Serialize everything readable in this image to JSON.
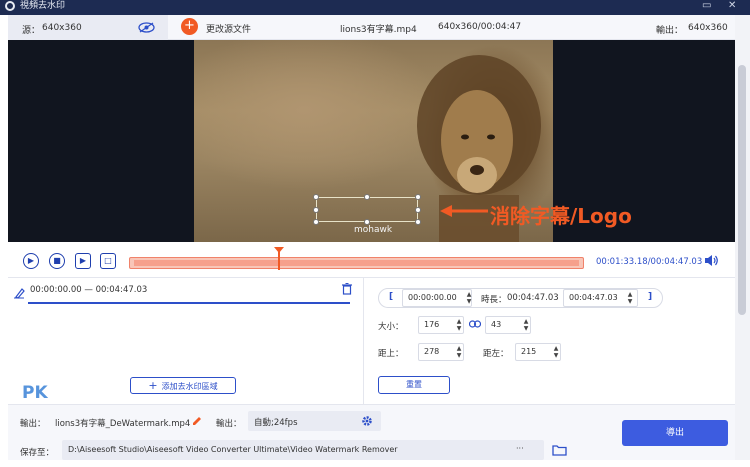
{
  "window": {
    "title": "視頻去水印",
    "min_icon": "minimize-icon",
    "close_icon": "close-icon"
  },
  "infobar": {
    "source_label": "源：",
    "source_res": "640x360",
    "change_source_label": "更改源文件",
    "file_name": "lions3有字幕.mp4",
    "file_info": "640x360/00:04:47",
    "output_label": "輸出：",
    "output_res": "640x360"
  },
  "video": {
    "watermark_text": "mohawk",
    "callout": "消除字幕/Logo"
  },
  "controls": {
    "time_display": "00:01:33.18/00:04:47.03",
    "accent_color": "#2d4fc9",
    "track_color": "#f6a08c"
  },
  "left_panel": {
    "range_text": "00:00:00.00 — 00:04:47.03",
    "add_button_label": "添加去水印區域"
  },
  "right_panel": {
    "bracket_open": "[",
    "bracket_close": "]",
    "start_time": "00:00:00.00",
    "duration_label": "時長：",
    "duration_value": "00:04:47.03",
    "end_time": "00:04:47.03",
    "size_label": "大小：",
    "width": "176",
    "height": "43",
    "top_label": "距上：",
    "top_value": "278",
    "left_label": "距左：",
    "left_value": "215",
    "reset_label": "重置"
  },
  "bottom": {
    "output_label": "輸出：",
    "output_file": "lions3有字幕_DeWatermark.mp4",
    "output_format_label": "輸出：",
    "output_format": "自動;24fps",
    "save_label": "保存至：",
    "save_path": "D:\\Aiseesoft Studio\\Aiseesoft Video Converter Ultimate\\Video Watermark Remover",
    "browse_label": "···",
    "export_label": "導出"
  },
  "logo": {
    "mark": "PK"
  }
}
